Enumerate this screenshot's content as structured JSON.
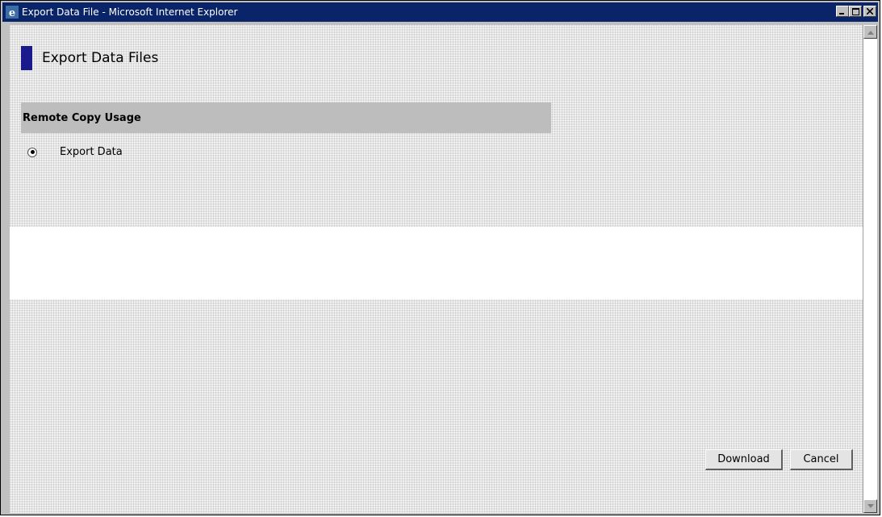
{
  "window": {
    "title": "Export Data File - Microsoft Internet Explorer",
    "controls": {
      "minimize": "_",
      "maximize": "□",
      "close": "×"
    }
  },
  "page": {
    "title": "Export Data Files"
  },
  "section": {
    "title": "Remote Copy Usage",
    "radio_label": "Export Data",
    "radio_selected": true
  },
  "buttons": {
    "download_label": "Download",
    "cancel_label": "Cancel"
  },
  "colors": {
    "titlebar": "#0a246a",
    "accent_block": "#1a1a8c",
    "section_header": "#bdbdbd"
  },
  "icons": {
    "app": "ie-icon",
    "scroll_up": "scroll-up-icon",
    "scroll_down": "scroll-down-icon"
  }
}
